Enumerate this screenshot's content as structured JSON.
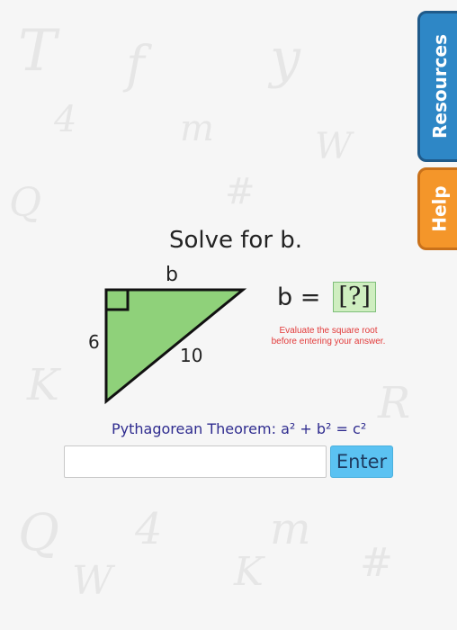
{
  "problem": {
    "title": "Solve for b.",
    "triangle": {
      "top_label": "b",
      "left_label": "6",
      "hypotenuse_label": "10",
      "fill_color": "#8fd17a",
      "stroke_color": "#111111"
    },
    "equation": {
      "lhs": "b =",
      "placeholder": "[?]"
    },
    "hint": "Evaluate the square root before entering your answer.",
    "theorem": {
      "label": "Pythagorean Theorem:",
      "formula": "a² + b² = c²"
    }
  },
  "answer": {
    "value": "",
    "enter_label": "Enter"
  },
  "side_tabs": {
    "resources": "Resources",
    "help": "Help"
  },
  "colors": {
    "resources_tab": "#2e87c6",
    "help_tab": "#f4962a",
    "enter_button": "#5bc2f2",
    "hint_text": "#e23a3a",
    "theorem_text": "#2f2c8f",
    "answer_box": "#cfeec0"
  }
}
